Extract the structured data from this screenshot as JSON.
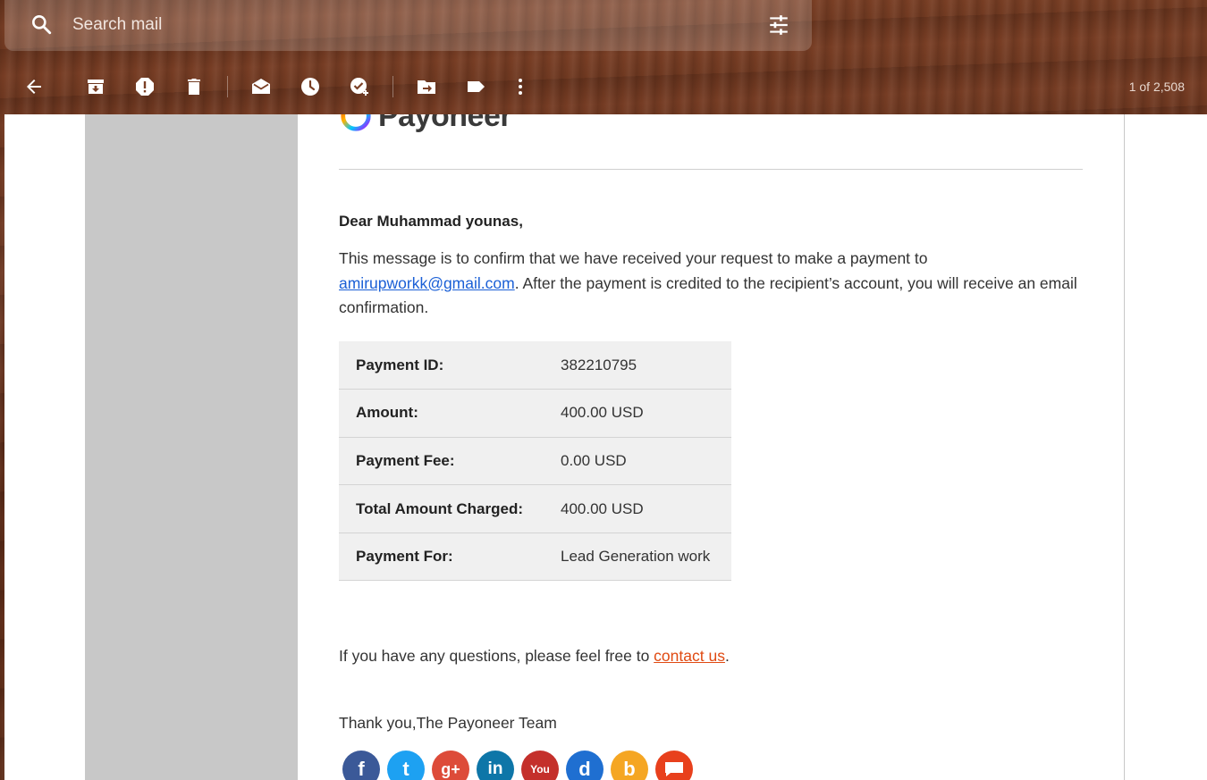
{
  "search": {
    "placeholder": "Search mail"
  },
  "toolbar": {
    "icons": [
      "back-arrow-icon",
      "archive-icon",
      "report-spam-icon",
      "delete-icon",
      "mark-unread-icon",
      "snooze-icon",
      "add-to-tasks-icon",
      "move-to-icon",
      "label-icon",
      "more-vert-icon"
    ],
    "counter": "1 of 2,508"
  },
  "email": {
    "logo_text": "Payoneer",
    "greeting": "Dear Muhammad younas,",
    "para_before": "This message is to confirm that we have received your request to make a payment to ",
    "recipient_email": "amirupworkk@gmail.com",
    "para_after": ". After the payment is credited to the recipient’s account, you will receive an email confirmation.",
    "details": [
      {
        "label": "Payment ID:",
        "value": "382210795"
      },
      {
        "label": "Amount:",
        "value": "400.00 USD"
      },
      {
        "label": "Payment Fee:",
        "value": "0.00 USD"
      },
      {
        "label": "Total Amount Charged:",
        "value": "400.00 USD"
      },
      {
        "label": "Payment For:",
        "value": "Lead Generation work"
      }
    ],
    "questions_before": "If you have any questions, please feel free to ",
    "contact_link": "contact us",
    "questions_after": ".",
    "thanks": "Thank you,The Payoneer Team",
    "socials": [
      {
        "name": "facebook-icon",
        "glyph": "f",
        "color": "#3b5998"
      },
      {
        "name": "twitter-icon",
        "glyph": "t",
        "color": "#1da1f2"
      },
      {
        "name": "google-plus-icon",
        "glyph": "g+",
        "color": "#dd4b39"
      },
      {
        "name": "linkedin-icon",
        "glyph": "in",
        "color": "#0e76a8"
      },
      {
        "name": "youtube-icon",
        "glyph": "You",
        "color": "#c4302b"
      },
      {
        "name": "d-icon",
        "glyph": "d",
        "color": "#1f6fd1"
      },
      {
        "name": "blogger-icon",
        "glyph": "b",
        "color": "#f5a623"
      },
      {
        "name": "chat-icon",
        "glyph": "",
        "color": "#e8401c"
      }
    ]
  }
}
